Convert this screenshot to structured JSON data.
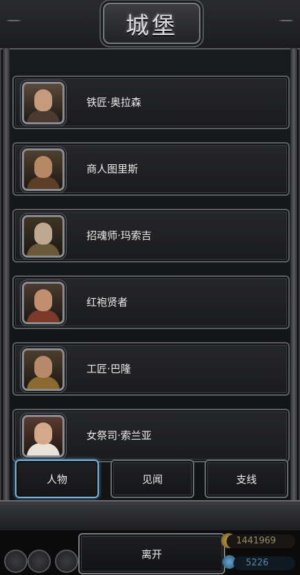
{
  "header": {
    "title": "城堡"
  },
  "characters": [
    {
      "name": "铁匠·奥拉森",
      "face": "#c69a7c",
      "body": "#4a3a30",
      "bg": "#5a4a3c"
    },
    {
      "name": "商人图里斯",
      "face": "#b78866",
      "body": "#5b3f28",
      "bg": "#4f4130"
    },
    {
      "name": "招魂师·玛索吉",
      "face": "#bfa890",
      "body": "#6b5a3a",
      "bg": "#3e3525"
    },
    {
      "name": "红袍贤者",
      "face": "#c28e70",
      "body": "#7a3a2a",
      "bg": "#4a3b30"
    },
    {
      "name": "工匠·巴隆",
      "face": "#b8896a",
      "body": "#8a6a30",
      "bg": "#4c3f2c"
    },
    {
      "name": "女祭司·索兰亚",
      "face": "#d4a88a",
      "body": "#e8e2d8",
      "bg": "#5a3a30"
    }
  ],
  "tabs": [
    {
      "label": "人物",
      "active": true
    },
    {
      "label": "见闻",
      "active": false
    },
    {
      "label": "支线",
      "active": false
    }
  ],
  "footer": {
    "leave_label": "离开",
    "gold": "1441969",
    "gems": "5226"
  }
}
